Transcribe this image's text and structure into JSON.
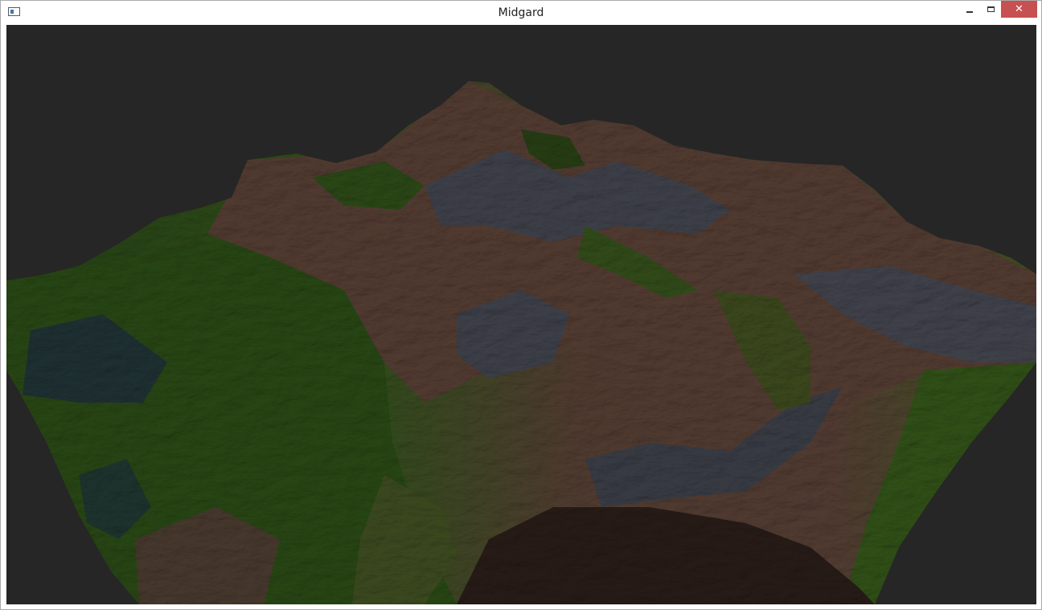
{
  "window": {
    "title": "Midgard",
    "close_glyph": "✕"
  },
  "icons": {
    "app": "application-window-icon",
    "minimize": "minimize-icon",
    "maximize": "maximize-icon",
    "close": "close-icon"
  },
  "colors": {
    "viewport_background": "#262626",
    "close_button": "#c75050",
    "terrain_green": "#3f6a1e",
    "terrain_brown": "#7a5848",
    "terrain_grey": "#5c5f6c"
  }
}
